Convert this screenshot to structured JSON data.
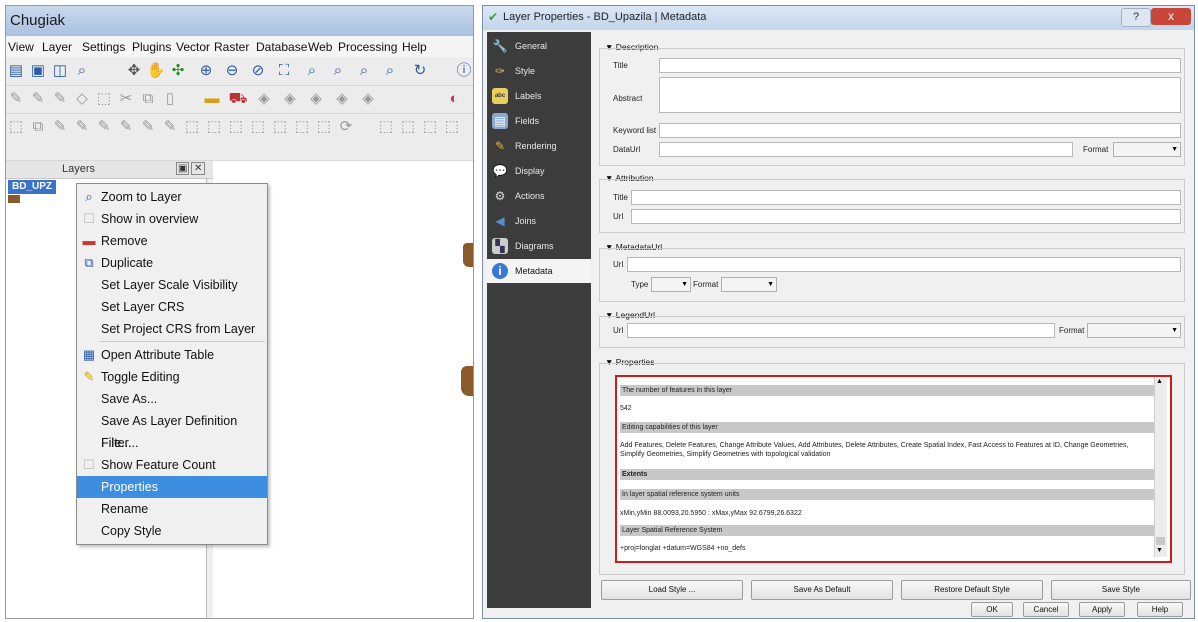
{
  "qgis": {
    "title": "Chugiak",
    "menu": [
      "View",
      "Layer",
      "Settings",
      "Plugins",
      "Vector",
      "Raster",
      "Database",
      "Web",
      "Processing",
      "Help"
    ],
    "layers_panel_title": "Layers",
    "layer_name": "BD_UPZ",
    "context_menu": [
      {
        "label": "Zoom to Layer",
        "icon": "zoom-icon"
      },
      {
        "label": "Show in overview",
        "icon": "checkbox-icon"
      },
      {
        "label": "Remove",
        "icon": "remove-icon"
      },
      {
        "label": "Duplicate",
        "icon": "duplicate-icon"
      },
      {
        "label": "Set Layer Scale Visibility",
        "icon": ""
      },
      {
        "label": "Set Layer CRS",
        "icon": ""
      },
      {
        "label": "Set Project CRS from Layer",
        "icon": ""
      },
      {
        "label": "Open Attribute Table",
        "icon": "table-icon"
      },
      {
        "label": "Toggle Editing",
        "icon": "pencil-icon"
      },
      {
        "label": "Save As...",
        "icon": ""
      },
      {
        "label": "Save As Layer Definition File...",
        "icon": ""
      },
      {
        "label": "Filter...",
        "icon": ""
      },
      {
        "label": "Show Feature Count",
        "icon": "checkbox-icon"
      },
      {
        "label": "Properties",
        "icon": "",
        "selected": true
      },
      {
        "label": "Rename",
        "icon": ""
      },
      {
        "label": "Copy Style",
        "icon": ""
      }
    ]
  },
  "dialog": {
    "title": "Layer Properties - BD_Upazila | Metadata",
    "help": "?",
    "close": "x",
    "nav": [
      {
        "label": "General",
        "icon": "wrench-icon"
      },
      {
        "label": "Style",
        "icon": "brush-icon"
      },
      {
        "label": "Labels",
        "icon": "abc-icon"
      },
      {
        "label": "Fields",
        "icon": "fields-icon"
      },
      {
        "label": "Rendering",
        "icon": "paint-icon"
      },
      {
        "label": "Display",
        "icon": "speech-bubble-icon"
      },
      {
        "label": "Actions",
        "icon": "gear-icon"
      },
      {
        "label": "Joins",
        "icon": "join-icon"
      },
      {
        "label": "Diagrams",
        "icon": "diagram-icon"
      },
      {
        "label": "Metadata",
        "icon": "info-icon",
        "selected": true
      }
    ],
    "description": {
      "header": "Description",
      "title_label": "Title",
      "abstract_label": "Abstract",
      "keyword_label": "Keyword list",
      "dataurl_label": "DataUrl",
      "format_label": "Format"
    },
    "attribution": {
      "header": "Attribution",
      "title_label": "Title",
      "url_label": "Url"
    },
    "metadataurl": {
      "header": "MetadataUrl",
      "url_label": "Url",
      "type_label": "Type",
      "format_label": "Format"
    },
    "legendurl": {
      "header": "LegendUrl",
      "url_label": "Url",
      "format_label": "Format"
    },
    "properties": {
      "header": "Properties",
      "rows": [
        {
          "text": "The number of features in this layer",
          "kind": "h"
        },
        {
          "text": "542",
          "kind": "t"
        },
        {
          "text": "Editing capabilities of this layer",
          "kind": "h"
        },
        {
          "text": "Add Features, Delete Features, Change Attribute Values, Add Attributes, Delete Attributes, Create Spatial Index, Fast Access to Features at ID, Change Geometries, Simplify Geometries, Simplify Geometries with topological validation",
          "kind": "t"
        },
        {
          "text": "Extents",
          "kind": "hb"
        },
        {
          "text": "In layer spatial reference system units",
          "kind": "h"
        },
        {
          "text": "xMin,yMin 88.0093,20.5950 : xMax,yMax 92.6799,26.6322",
          "kind": "t"
        },
        {
          "text": "Layer Spatial Reference System",
          "kind": "h"
        },
        {
          "text": "+proj=longlat +datum=WGS84 +no_defs",
          "kind": "t"
        }
      ]
    },
    "style_buttons": [
      "Load Style ...",
      "Save As Default",
      "Restore Default Style",
      "Save Style"
    ],
    "buttons": [
      "OK",
      "Cancel",
      "Apply",
      "Help"
    ]
  }
}
